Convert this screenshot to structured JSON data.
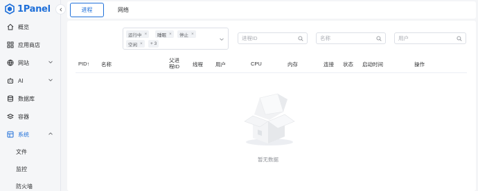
{
  "app": {
    "logo_text": "1Panel"
  },
  "sidebar": {
    "items": [
      {
        "label": "概览",
        "icon": "home-icon"
      },
      {
        "label": "应用商店",
        "icon": "apps-grid-icon"
      },
      {
        "label": "网站",
        "icon": "globe-icon",
        "expandable": true
      },
      {
        "label": "AI",
        "icon": "robot-icon",
        "expandable": true
      },
      {
        "label": "数据库",
        "icon": "database-icon"
      },
      {
        "label": "容器",
        "icon": "container-icon"
      },
      {
        "label": "系统",
        "icon": "system-icon",
        "expanded": true,
        "active": true
      }
    ],
    "subitems": [
      {
        "label": "文件"
      },
      {
        "label": "监控"
      },
      {
        "label": "防火墙"
      }
    ]
  },
  "tabs": [
    {
      "label": "进程",
      "active": true
    },
    {
      "label": "网络",
      "active": false
    }
  ],
  "filters": {
    "status_tags": [
      "运行中",
      "睡眠",
      "停止",
      "空闲"
    ],
    "more_count": "+ 3",
    "pid_placeholder": "进程ID",
    "name_placeholder": "名称",
    "user_placeholder": "用户"
  },
  "table": {
    "columns": [
      "PID",
      "名称",
      "父进程ID",
      "线程",
      "用户",
      "CPU",
      "内存",
      "连接",
      "状态",
      "启动时间",
      "操作"
    ],
    "sort_indicator": "↑",
    "empty_text": "暂无数据"
  },
  "colors": {
    "accent": "#1e6fd9",
    "border": "#dcdfe6",
    "muted": "#909399"
  }
}
